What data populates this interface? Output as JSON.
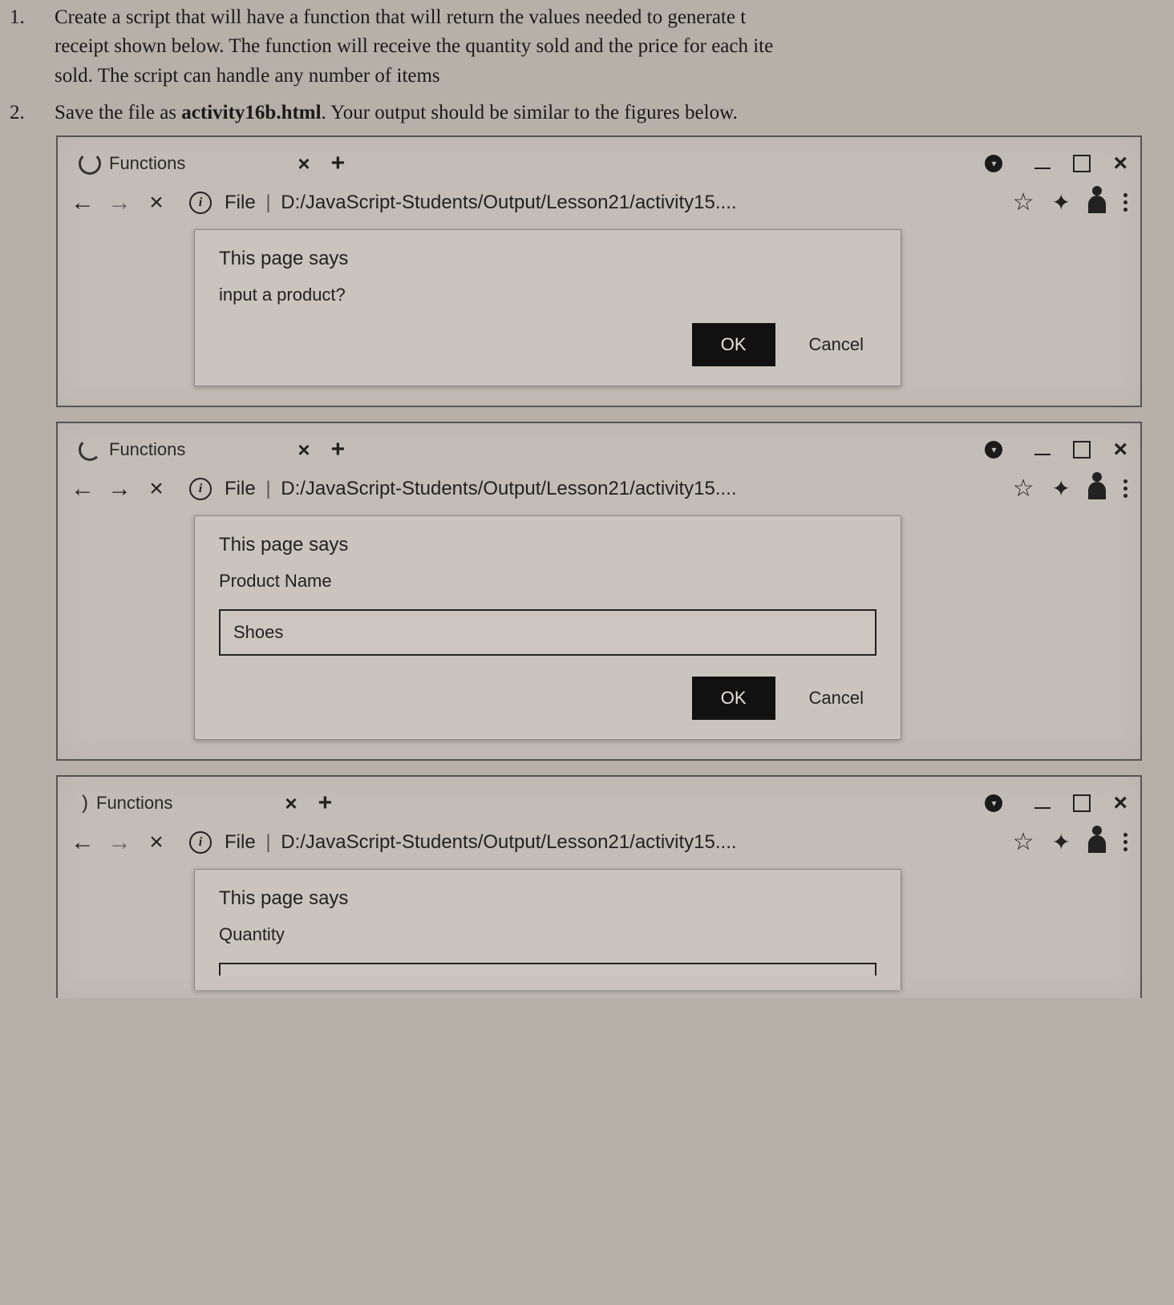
{
  "instructions": {
    "item1_partial": "Create a script that will have a function that will return the values needed to generate t",
    "item1_line2": "receipt shown below. The function will receive the quantity sold and the price for each ite",
    "item1_line3": "sold. The script can handle any number of items",
    "item2_pre": "Save the file as ",
    "item2_bold": "activity16b.html",
    "item2_post": ". Your output should be similar to the figures below."
  },
  "browser_common": {
    "tab_title": "Functions",
    "tab_close": "×",
    "new_tab": "+",
    "url_label_file": "File",
    "url_path": "D:/JavaScript-Students/Output/Lesson21/activity15....",
    "dialog_title": "This page says",
    "ok_label": "OK",
    "cancel_label": "Cancel"
  },
  "frame1": {
    "dialog_message": "input a product?",
    "has_input": false,
    "input_value": ""
  },
  "frame2": {
    "dialog_message": "Product Name",
    "has_input": true,
    "input_value": "Shoes"
  },
  "frame3": {
    "dialog_message": "Quantity",
    "has_input": true,
    "input_value": ""
  }
}
